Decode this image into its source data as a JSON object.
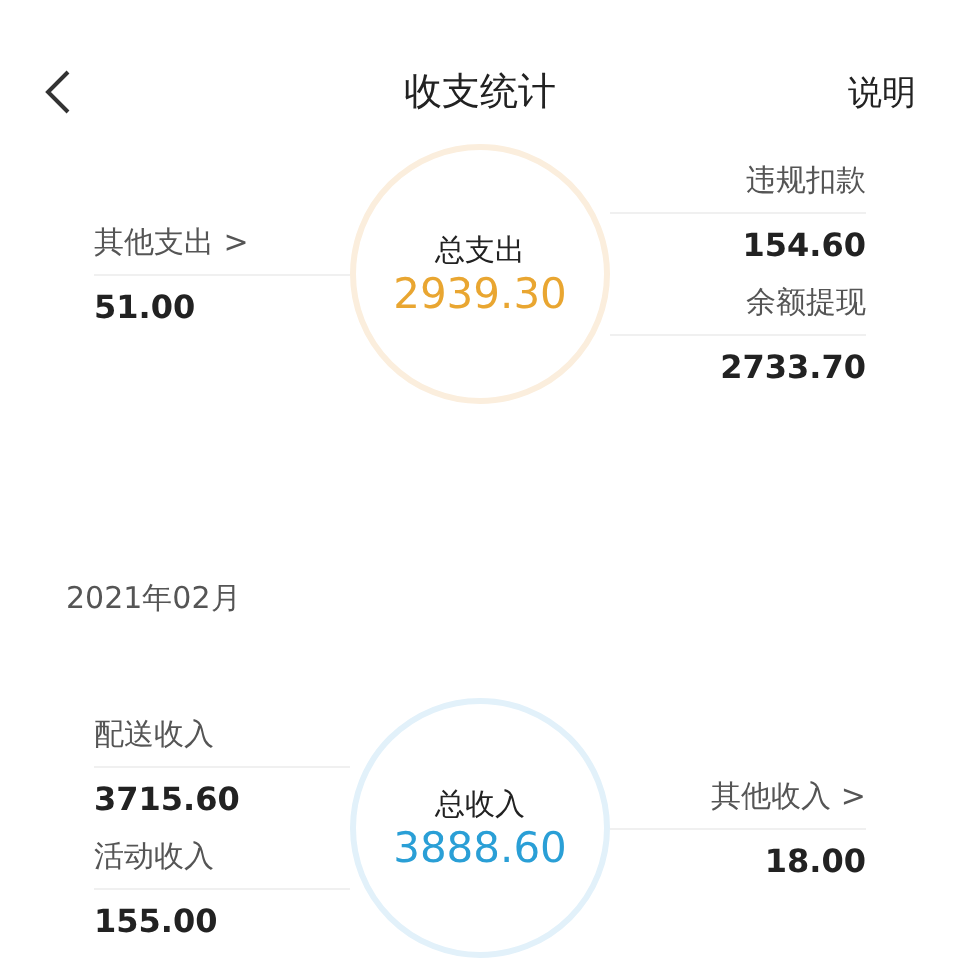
{
  "header": {
    "title": "收支统计",
    "action": "说明"
  },
  "sections": [
    {
      "kind": "expense",
      "center": {
        "label": "总支出",
        "value": "2939.30"
      },
      "left": [
        {
          "label": "其他支出 >",
          "value": "51.00"
        }
      ],
      "right": [
        {
          "label": "违规扣款",
          "value": "154.60"
        },
        {
          "label": "余额提现",
          "value": "2733.70"
        }
      ]
    },
    {
      "kind": "income",
      "date": "2021年02月",
      "center": {
        "label": "总收入",
        "value": "3888.60"
      },
      "left": [
        {
          "label": "配送收入",
          "value": "3715.60"
        },
        {
          "label": "活动收入",
          "value": "155.00"
        }
      ],
      "right": [
        {
          "label": "其他收入 >",
          "value": "18.00"
        }
      ]
    }
  ]
}
